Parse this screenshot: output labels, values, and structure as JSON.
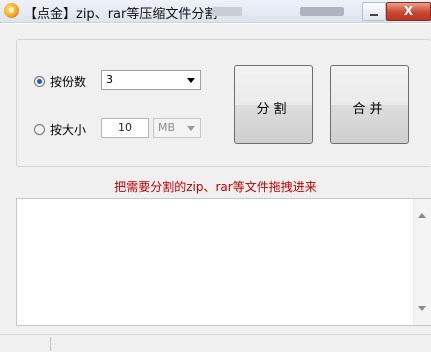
{
  "window": {
    "title": "【点金】zip、rar等压缩文件分割",
    "close_glyph": "X"
  },
  "options": {
    "by_count": {
      "label": "按份数",
      "checked": true,
      "selected_value": "3"
    },
    "by_size": {
      "label": "按大小",
      "checked": false,
      "size_value": "10",
      "unit_value": "MB"
    }
  },
  "buttons": {
    "split_label": "分割",
    "merge_label": "合并"
  },
  "hint_text": "把需要分割的zip、rar等文件拖拽进来",
  "drop_area": {
    "content": ""
  }
}
